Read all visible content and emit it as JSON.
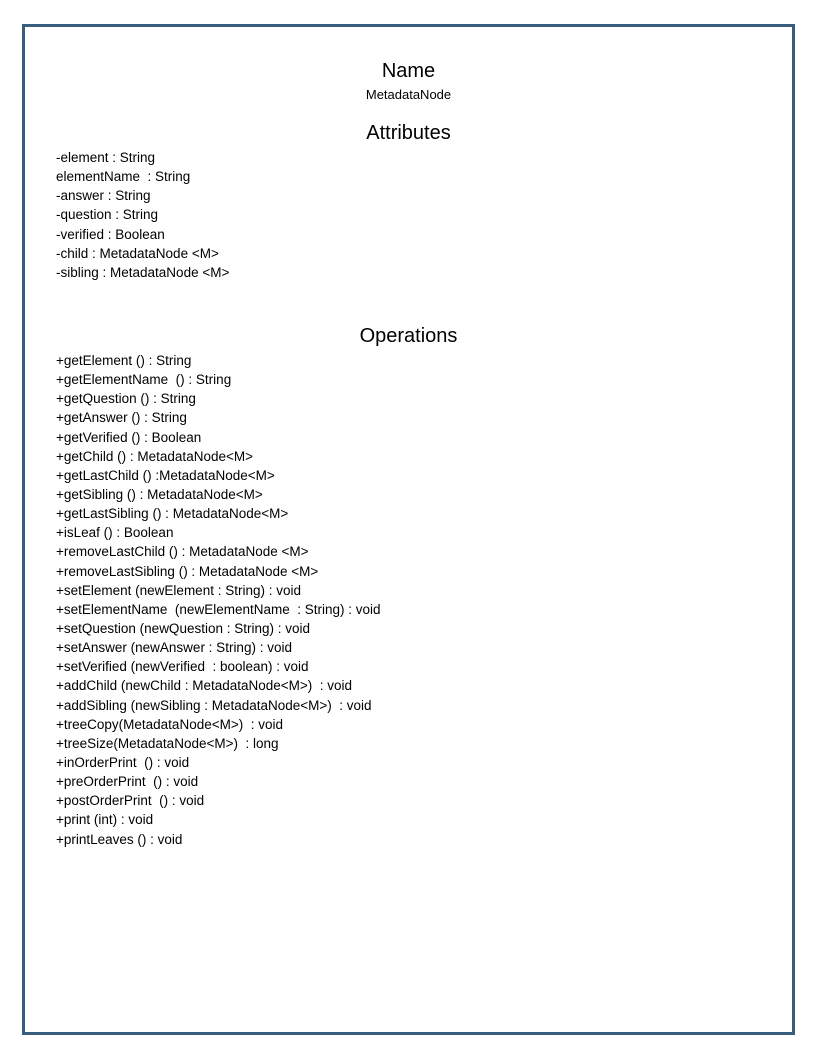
{
  "name_section": {
    "heading": "Name",
    "class_name": "MetadataNode"
  },
  "attributes_section": {
    "heading": "Attributes",
    "items": [
      "-element : String",
      "elementName  : String",
      "-answer : String",
      "-question : String",
      "-verified : Boolean",
      "-child : MetadataNode <M>",
      "-sibling : MetadataNode <M>"
    ]
  },
  "operations_section": {
    "heading": "Operations",
    "items": [
      "+getElement () : String",
      "+getElementName  () : String",
      "+getQuestion () : String",
      "+getAnswer () : String",
      "+getVerified () : Boolean",
      "+getChild () : MetadataNode<M>",
      "+getLastChild () :MetadataNode<M>",
      "+getSibling () : MetadataNode<M>",
      "+getLastSibling () : MetadataNode<M>",
      "+isLeaf () : Boolean",
      "+removeLastChild () : MetadataNode <M>",
      "+removeLastSibling () : MetadataNode <M>",
      "+setElement (newElement : String) : void",
      "+setElementName  (newElementName  : String) : void",
      "+setQuestion (newQuestion : String) : void",
      "+setAnswer (newAnswer : String) : void",
      "+setVerified (newVerified  : boolean) : void",
      "+addChild (newChild : MetadataNode<M>)  : void",
      "+addSibling (newSibling : MetadataNode<M>)  : void",
      "+treeCopy(MetadataNode<M>)  : void",
      "+treeSize(MetadataNode<M>)  : long",
      "+inOrderPrint  () : void",
      "+preOrderPrint  () : void",
      "+postOrderPrint  () : void",
      "+print (int) : void",
      "+printLeaves () : void"
    ]
  },
  "colors": {
    "border": "#385d7e",
    "text": "#000000",
    "background": "#ffffff"
  }
}
